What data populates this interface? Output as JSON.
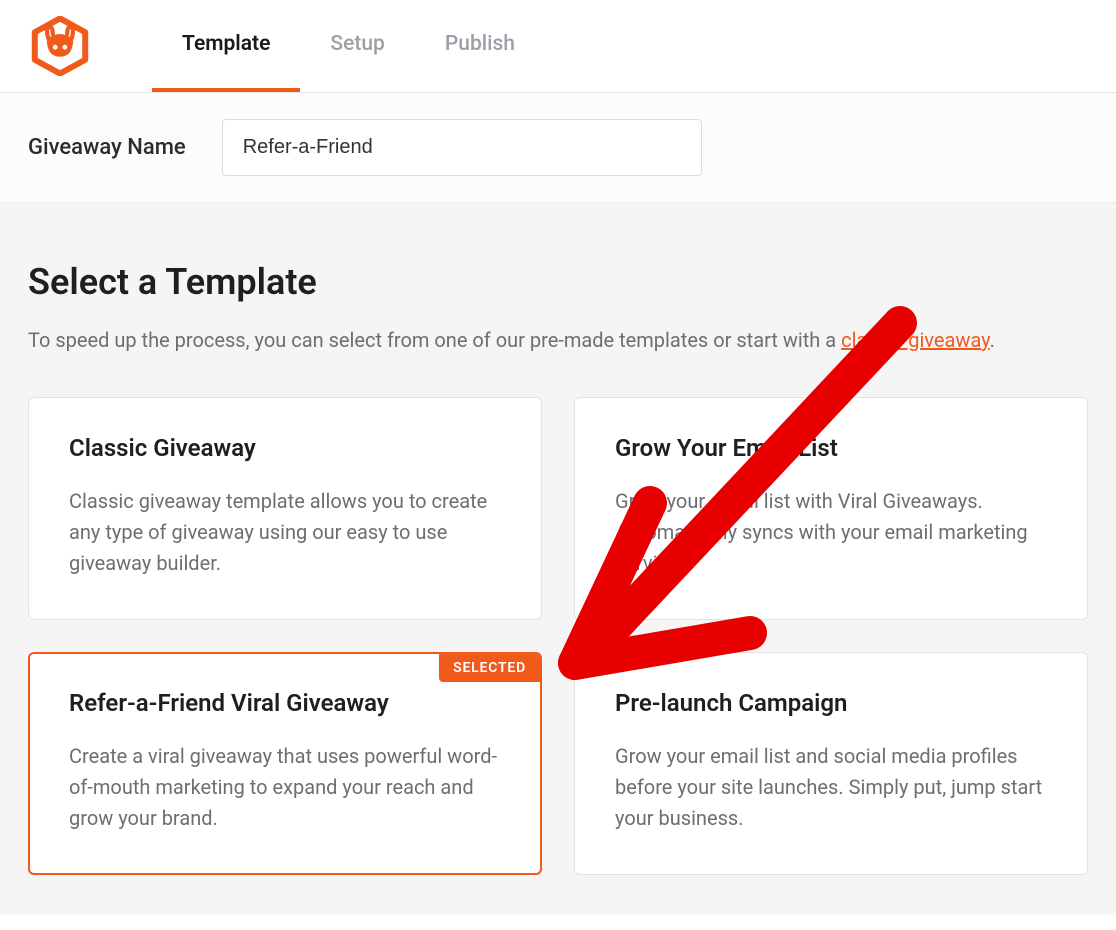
{
  "tabs": {
    "template": "Template",
    "setup": "Setup",
    "publish": "Publish"
  },
  "namebar": {
    "label": "Giveaway Name",
    "value": "Refer-a-Friend"
  },
  "page": {
    "heading": "Select a Template",
    "lead_prefix": "To speed up the process, you can select from one of our pre-made templates or start with a ",
    "lead_link": "classic giveaway",
    "lead_suffix": "."
  },
  "cards": {
    "classic": {
      "title": "Classic Giveaway",
      "desc": "Classic giveaway template allows you to create any type of giveaway using our easy to use giveaway builder."
    },
    "grow": {
      "title": "Grow Your Email List",
      "desc": "Grow your email list with Viral Giveaways. Automatically syncs with your email marketing service."
    },
    "refer": {
      "title": "Refer-a-Friend Viral Giveaway",
      "desc": "Create a viral giveaway that uses powerful word-of-mouth marketing to expand your reach and grow your brand.",
      "badge": "SELECTED"
    },
    "prelaunch": {
      "title": "Pre-launch Campaign",
      "desc": "Grow your email list and social media profiles before your site launches. Simply put, jump start your business."
    }
  }
}
